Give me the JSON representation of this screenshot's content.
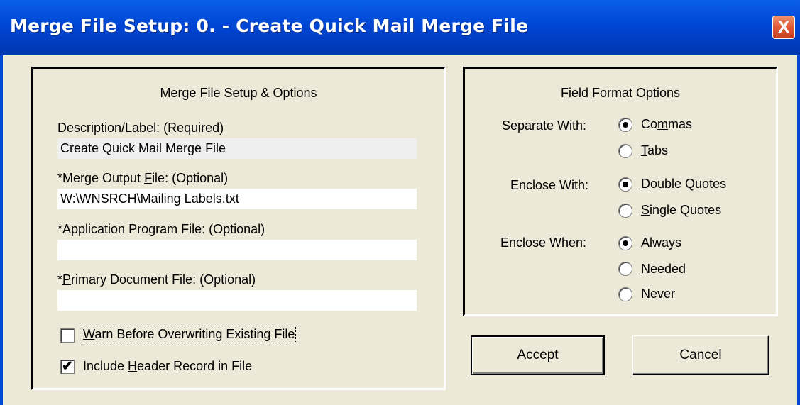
{
  "window": {
    "title": "Merge File Setup:  0. - Create Quick Mail Merge File",
    "close_label": "X"
  },
  "left_group": {
    "title": "Merge File Setup & Options",
    "description": {
      "label": "Description/Label: (Required)",
      "value": "Create Quick Mail Merge File"
    },
    "merge_output": {
      "label_pre": "*Merge Output ",
      "label_mnemonic": "F",
      "label_post": "ile: (Optional)",
      "value": "W:\\WNSRCH\\Mailing Labels.txt"
    },
    "app_program": {
      "label": "*Application Program File: (Optional)",
      "value": ""
    },
    "primary_doc": {
      "label_pre": "*",
      "label_mnemonic": "P",
      "label_post": "rimary Document File: (Optional)",
      "value": ""
    },
    "warn_overwrite": {
      "label_mnemonic": "W",
      "label_post": "arn Before Overwriting Existing File",
      "checked": false
    },
    "include_header": {
      "label_pre": "Include ",
      "label_mnemonic": "H",
      "label_post": "eader Record in File",
      "checked": true,
      "check_mark": "✔"
    }
  },
  "right_group": {
    "title": "Field Format Options",
    "separate": {
      "label": "Separate With:",
      "options": [
        {
          "pre": "Co",
          "mn": "m",
          "post": "mas",
          "selected": true
        },
        {
          "pre": "",
          "mn": "T",
          "post": "abs",
          "selected": false
        }
      ]
    },
    "enclose_with": {
      "label": "Enclose With:",
      "options": [
        {
          "pre": "",
          "mn": "D",
          "post": "ouble Quotes",
          "selected": true
        },
        {
          "pre": "",
          "mn": "S",
          "post": "ingle Quotes",
          "selected": false
        }
      ]
    },
    "enclose_when": {
      "label": "Enclose When:",
      "options": [
        {
          "pre": "Alwa",
          "mn": "y",
          "post": "s",
          "selected": true
        },
        {
          "pre": "",
          "mn": "N",
          "post": "eeded",
          "selected": false
        },
        {
          "pre": "Ne",
          "mn": "v",
          "post": "er",
          "selected": false
        }
      ]
    }
  },
  "buttons": {
    "accept": {
      "mn": "A",
      "post": "ccept"
    },
    "cancel": {
      "mn": "C",
      "post": "ancel"
    }
  },
  "colors": {
    "title_bar": "#0046d5",
    "dialog_bg": "#ece9d8",
    "close_button": "#e05a33"
  }
}
